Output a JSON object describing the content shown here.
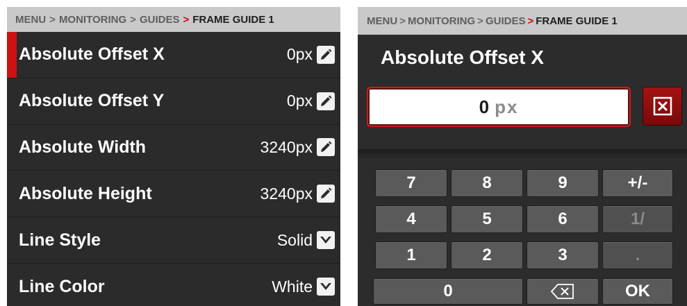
{
  "left_panel": {
    "breadcrumb": {
      "items": [
        "MENU",
        "MONITORING",
        "GUIDES"
      ],
      "current": "FRAME GUIDE 1",
      "separator": ">"
    },
    "rows": [
      {
        "label": "Absolute Offset X",
        "value": "0px",
        "control": "pencil-icon",
        "selected": true
      },
      {
        "label": "Absolute Offset Y",
        "value": "0px",
        "control": "pencil-icon",
        "selected": false
      },
      {
        "label": "Absolute Width",
        "value": "3240px",
        "control": "pencil-icon",
        "selected": false
      },
      {
        "label": "Absolute Height",
        "value": "3240px",
        "control": "pencil-icon",
        "selected": false
      },
      {
        "label": "Line Style",
        "value": "Solid",
        "control": "chevron-down-icon",
        "selected": false
      },
      {
        "label": "Line Color",
        "value": "White",
        "control": "chevron-down-icon",
        "selected": false
      }
    ]
  },
  "right_panel": {
    "breadcrumb": {
      "items": [
        "MENU",
        "MONITORING",
        "GUIDES"
      ],
      "current": "FRAME GUIDE 1",
      "separator": ">"
    },
    "title": "Absolute Offset X",
    "input": {
      "value": "0",
      "unit": "px"
    },
    "clear_icon": "close-box-icon",
    "keypad": {
      "row1": [
        "7",
        "8",
        "9",
        "+/-"
      ],
      "row2": [
        "4",
        "5",
        "6",
        "1/"
      ],
      "row3": [
        "1",
        "2",
        "3",
        "."
      ],
      "row4": [
        "0",
        "backspace-icon",
        "OK"
      ]
    }
  },
  "colors": {
    "accent_red": "#cc1212",
    "panel_bg": "#2b2b2b",
    "breadcrumb_bg": "#c9c9c9",
    "key_bg": "#5a5a5a"
  }
}
